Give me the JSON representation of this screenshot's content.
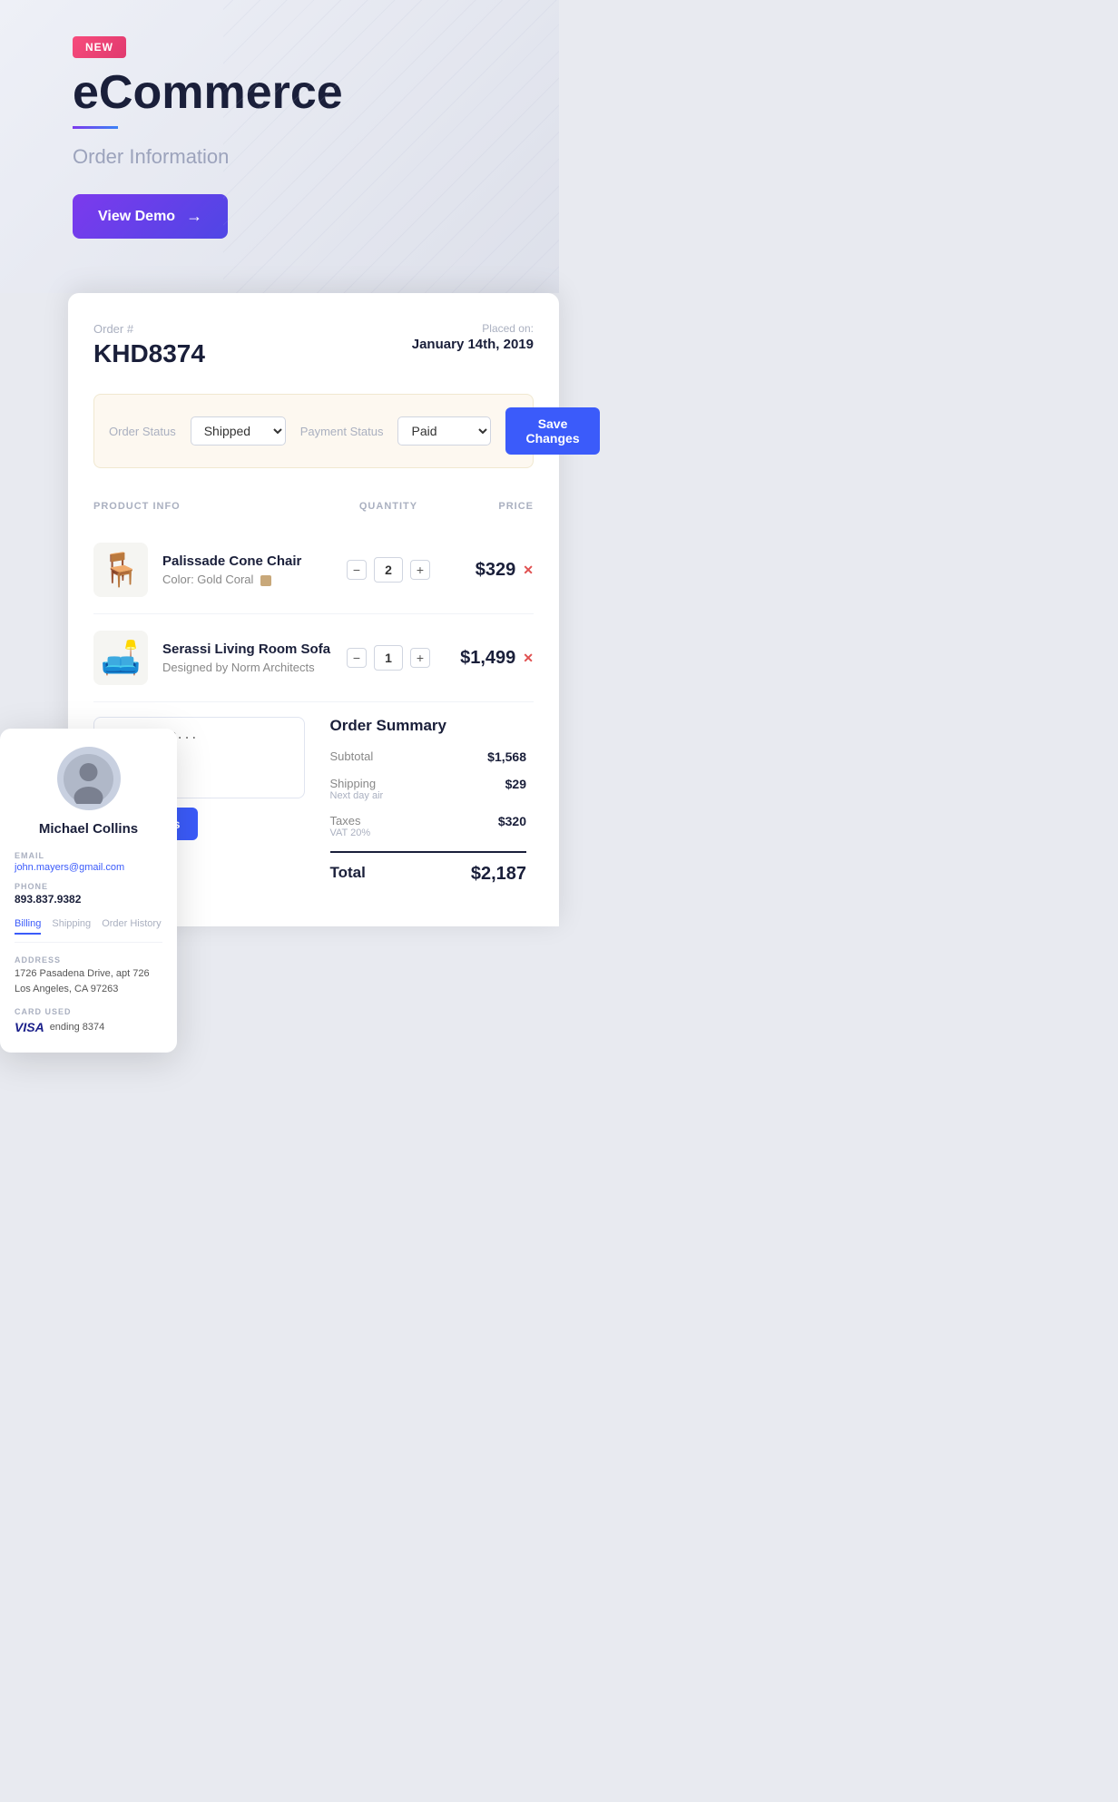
{
  "hero": {
    "badge": "NEW",
    "title": "eCommerce",
    "subtitle": "Order Information",
    "demo_btn": "View Demo"
  },
  "order": {
    "label": "Order #",
    "number": "KHD8374",
    "placed_label": "Placed on:",
    "placed_date": "January 14th, 2019"
  },
  "status_bar": {
    "order_status_label": "Order Status",
    "order_status_value": "Shipped",
    "payment_status_label": "Payment Status",
    "payment_status_value": "Paid",
    "save_btn": "Save Changes"
  },
  "columns": {
    "product_info": "PRODUCT INFO",
    "quantity": "QUANTITY",
    "price": "PRICE"
  },
  "products": [
    {
      "name": "Palissade Cone Chair",
      "sub_label": "Color:",
      "sub_value": "Gold Coral",
      "color": "#c8a87a",
      "quantity": 2,
      "price": "$329",
      "icon": "🪑"
    },
    {
      "name": "Serassi Living Room Sofa",
      "sub_label": "Designed by",
      "sub_value": "Norm Architects",
      "color": null,
      "quantity": 1,
      "price": "$1,499",
      "icon": "🛋️"
    }
  ],
  "customer": {
    "name": "Michael Collins",
    "email_label": "EMAIL",
    "email": "john.mayers@gmail.com",
    "phone_label": "PHONE",
    "phone": "893.837.9382",
    "tabs": [
      "Billing",
      "Shipping",
      "Order History"
    ],
    "active_tab": "Billing",
    "address_label": "ADDRESS",
    "address_line1": "1726 Pasadena Drive, apt 726",
    "address_line2": "Los Angeles, CA 97263",
    "card_label": "CARD USED",
    "card_brand": "VISA",
    "card_ending": "ending 8374"
  },
  "notes": {
    "placeholder": "notes here...",
    "save_btn": "Save Notes"
  },
  "summary": {
    "title": "Order Summary",
    "subtotal_label": "Subtotal",
    "subtotal_val": "$1,568",
    "shipping_label": "Shipping",
    "shipping_sub": "Next day air",
    "shipping_val": "$29",
    "taxes_label": "Taxes",
    "taxes_sub": "VAT 20%",
    "taxes_val": "$320",
    "total_label": "Total",
    "total_val": "$2,187"
  }
}
